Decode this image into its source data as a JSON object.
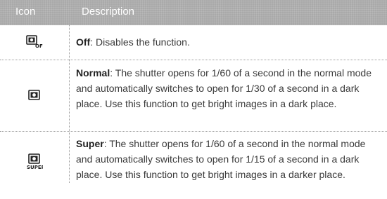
{
  "header": {
    "icon": "Icon",
    "description": "Description"
  },
  "rows": [
    {
      "icon": "shutter-off-icon",
      "icon_label": "OFF",
      "name": "Off",
      "text": ": Disables the function."
    },
    {
      "icon": "shutter-normal-icon",
      "icon_label": "",
      "name": "Normal",
      "text": ": The shutter opens for 1/60 of a second in the normal mode and automatically switches to open for 1/30 of a second in a dark place. Use this function to get bright images in a dark place."
    },
    {
      "icon": "shutter-super-icon",
      "icon_label": "SUPER",
      "name": "Super",
      "text": ": The shutter opens for 1/60 of a second in the normal mode and automatically switches to open for 1/15 of a second in a dark place. Use this function to get bright images in a darker place."
    }
  ],
  "colors": {
    "header_bg": "#a9a9a9",
    "header_text": "#ffffff",
    "body_text": "#3a3a3a"
  }
}
